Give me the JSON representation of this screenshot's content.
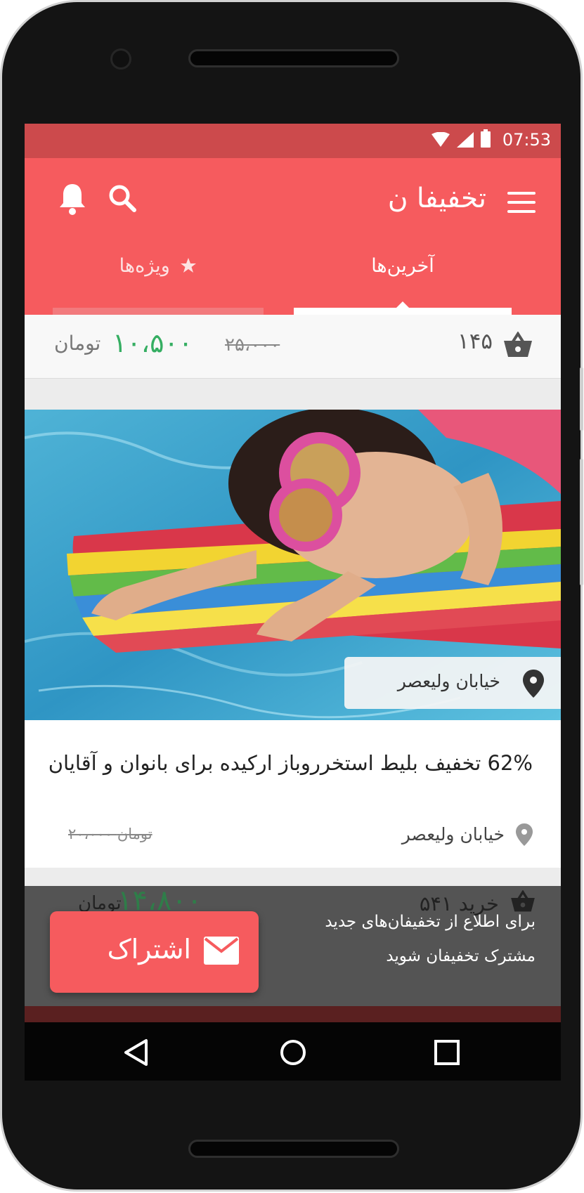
{
  "status": {
    "time": "07:53"
  },
  "app": {
    "title": "تخفیفا ن",
    "accent": "#f65b5e",
    "statusbar_color": "#cc4a4c",
    "tabs": [
      {
        "label": "آخرین‌ها",
        "active": true
      },
      {
        "label": "ویژه‌ها",
        "icon": "star-icon",
        "active": false
      }
    ]
  },
  "summary": {
    "count": "۱۴۵",
    "old_price": "۲۵،۰۰۰",
    "new_price": "۱۰،۵۰۰",
    "currency": "تومان",
    "price_color": "#35ae62"
  },
  "deal": {
    "location_chip": "خیابان ولیعصر",
    "title": "62% تخفیف بلیط استخررو‌باز ارکیده برای بانوان و آقایان",
    "location": "خیابان ولیعصر",
    "old_price": "۲۰،۰۰۰ تومان",
    "new_price": "۱۴،۸۰۰",
    "currency": "تومان",
    "buy_count": "۵۴۱ خرید"
  },
  "subscribe": {
    "line1": "برای اطلاع از تخفیفان‌های جدید",
    "line2": "مشترک تخفیفان شوید",
    "button_label": "اشتراک"
  }
}
